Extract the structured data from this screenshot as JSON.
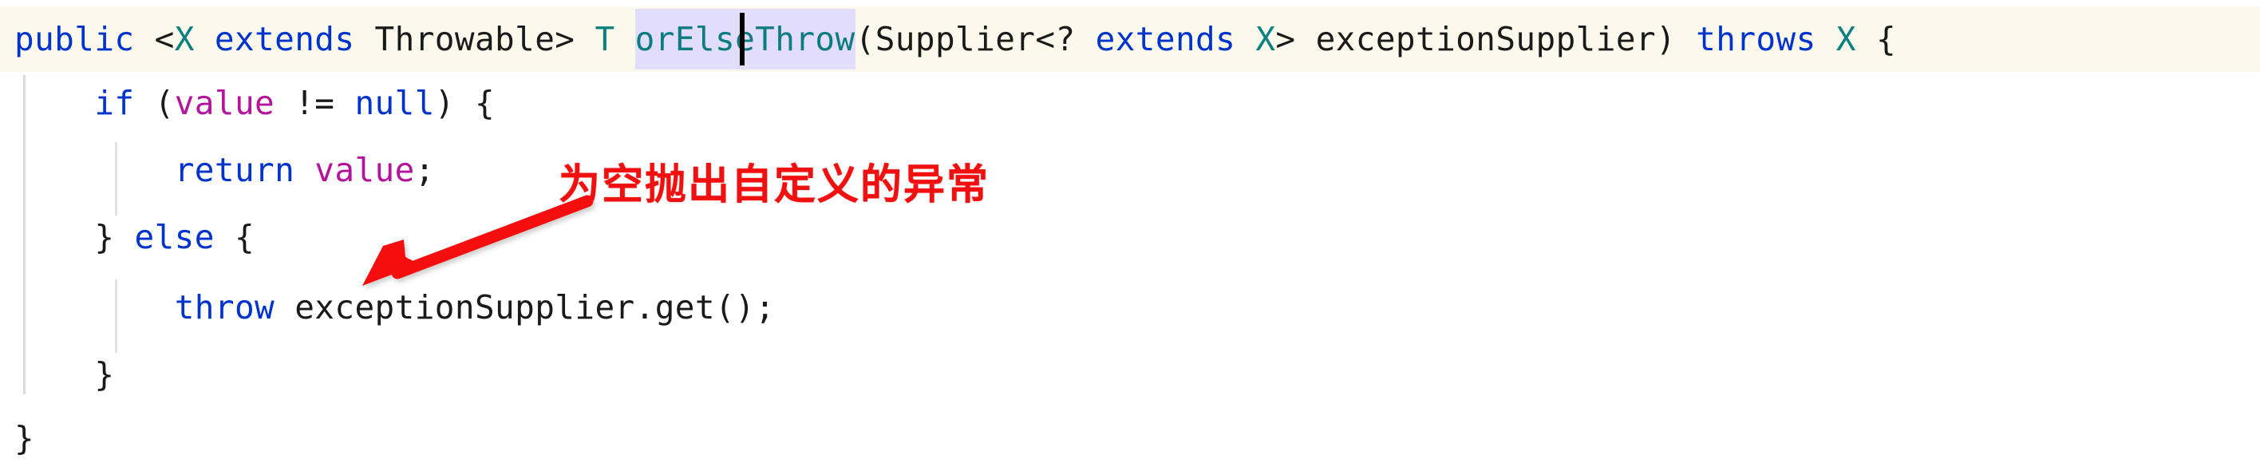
{
  "editor": {
    "language": "java",
    "background_color": "#ffffff",
    "current_line_color": "#fbf9ec",
    "selection_highlight_color": "#e2ddfa",
    "caret_color": "#000000",
    "annotation_color": "#f01010"
  },
  "code": {
    "line1": {
      "t1": "public",
      "t2": " <",
      "t3": "X",
      "t4": " ",
      "t5": "extends",
      "t6": " Throwable> ",
      "t7": "T",
      "t8": " ",
      "method_name": "orElseThrow",
      "t9": "(Supplier<? ",
      "t10": "extends",
      "t11": " ",
      "t12": "X",
      "t13": "> exceptionSupplier) ",
      "t14": "throws",
      "t15": " ",
      "t16": "X",
      "t17": " {"
    },
    "line2": {
      "indent": "    ",
      "t1": "if",
      "t2": " (",
      "t3": "value",
      "t4": " != ",
      "t5": "null",
      "t6": ") {"
    },
    "line3": {
      "indent": "        ",
      "t1": "return",
      "t2": " ",
      "t3": "value",
      "t4": ";"
    },
    "line4": {
      "indent": "    ",
      "t1": "} ",
      "t2": "else",
      "t3": " {"
    },
    "line5": {
      "indent": "        ",
      "t1": "throw",
      "t2": " exceptionSupplier.get();"
    },
    "line6": {
      "indent": "    ",
      "t1": "}"
    },
    "line7": {
      "indent": "",
      "t1": "}"
    }
  },
  "annotation": {
    "text": "为空抛出自定义的异常",
    "arrow": "red-arrow-pointing-down-left"
  }
}
